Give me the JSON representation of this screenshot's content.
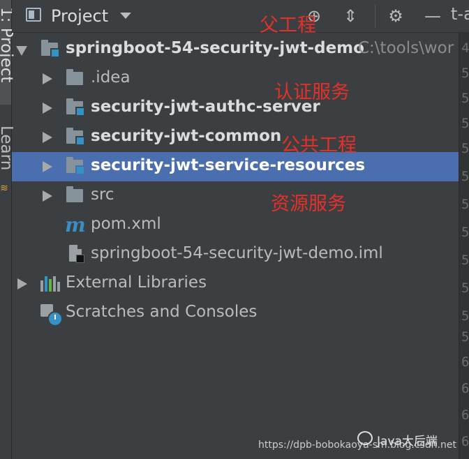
{
  "left_strip": {
    "tab_label": "1: Project",
    "second_label": "Learn"
  },
  "header": {
    "title": "Project",
    "top_right_fragment": "t-a",
    "buttons": [
      "locate-icon",
      "collapse-all-icon",
      "gear-icon",
      "minimize-icon"
    ]
  },
  "tree": {
    "root": {
      "label": "springboot-54-security-jwt-demo",
      "path": "C:\\tools\\wor",
      "expanded": true
    },
    "children": [
      {
        "label": ".idea",
        "type": "folder",
        "bold": false
      },
      {
        "label": "security-jwt-authc-server",
        "type": "module",
        "bold": true
      },
      {
        "label": "security-jwt-common",
        "type": "module",
        "bold": true
      },
      {
        "label": "security-jwt-service-resources",
        "type": "module",
        "bold": true,
        "selected": true
      },
      {
        "label": "src",
        "type": "folder",
        "bold": false
      },
      {
        "label": "pom.xml",
        "type": "maven"
      },
      {
        "label": "springboot-54-security-jwt-demo.iml",
        "type": "iml"
      }
    ],
    "external_libraries": "External Libraries",
    "scratches": "Scratches and Consoles"
  },
  "annotations": {
    "parent_project": "父工程",
    "auth_service": "认证服务",
    "common_project": "公共工程",
    "resource_service": "资源服务"
  },
  "gutter_numbers": [
    "4",
    "5",
    "5",
    "5",
    "5",
    "5",
    "5",
    "5",
    "5",
    "5",
    "5",
    "5",
    "6",
    "6",
    "6",
    "6"
  ],
  "watermark": {
    "brand": "Java大后端",
    "url": "https://dpb-bobokaoya-sm.blog.csdn.net"
  },
  "colors": {
    "background": "#3c3f41",
    "selection": "#4b6eaf",
    "annotation": "#e5302a",
    "module_mark": "#3592c4"
  }
}
